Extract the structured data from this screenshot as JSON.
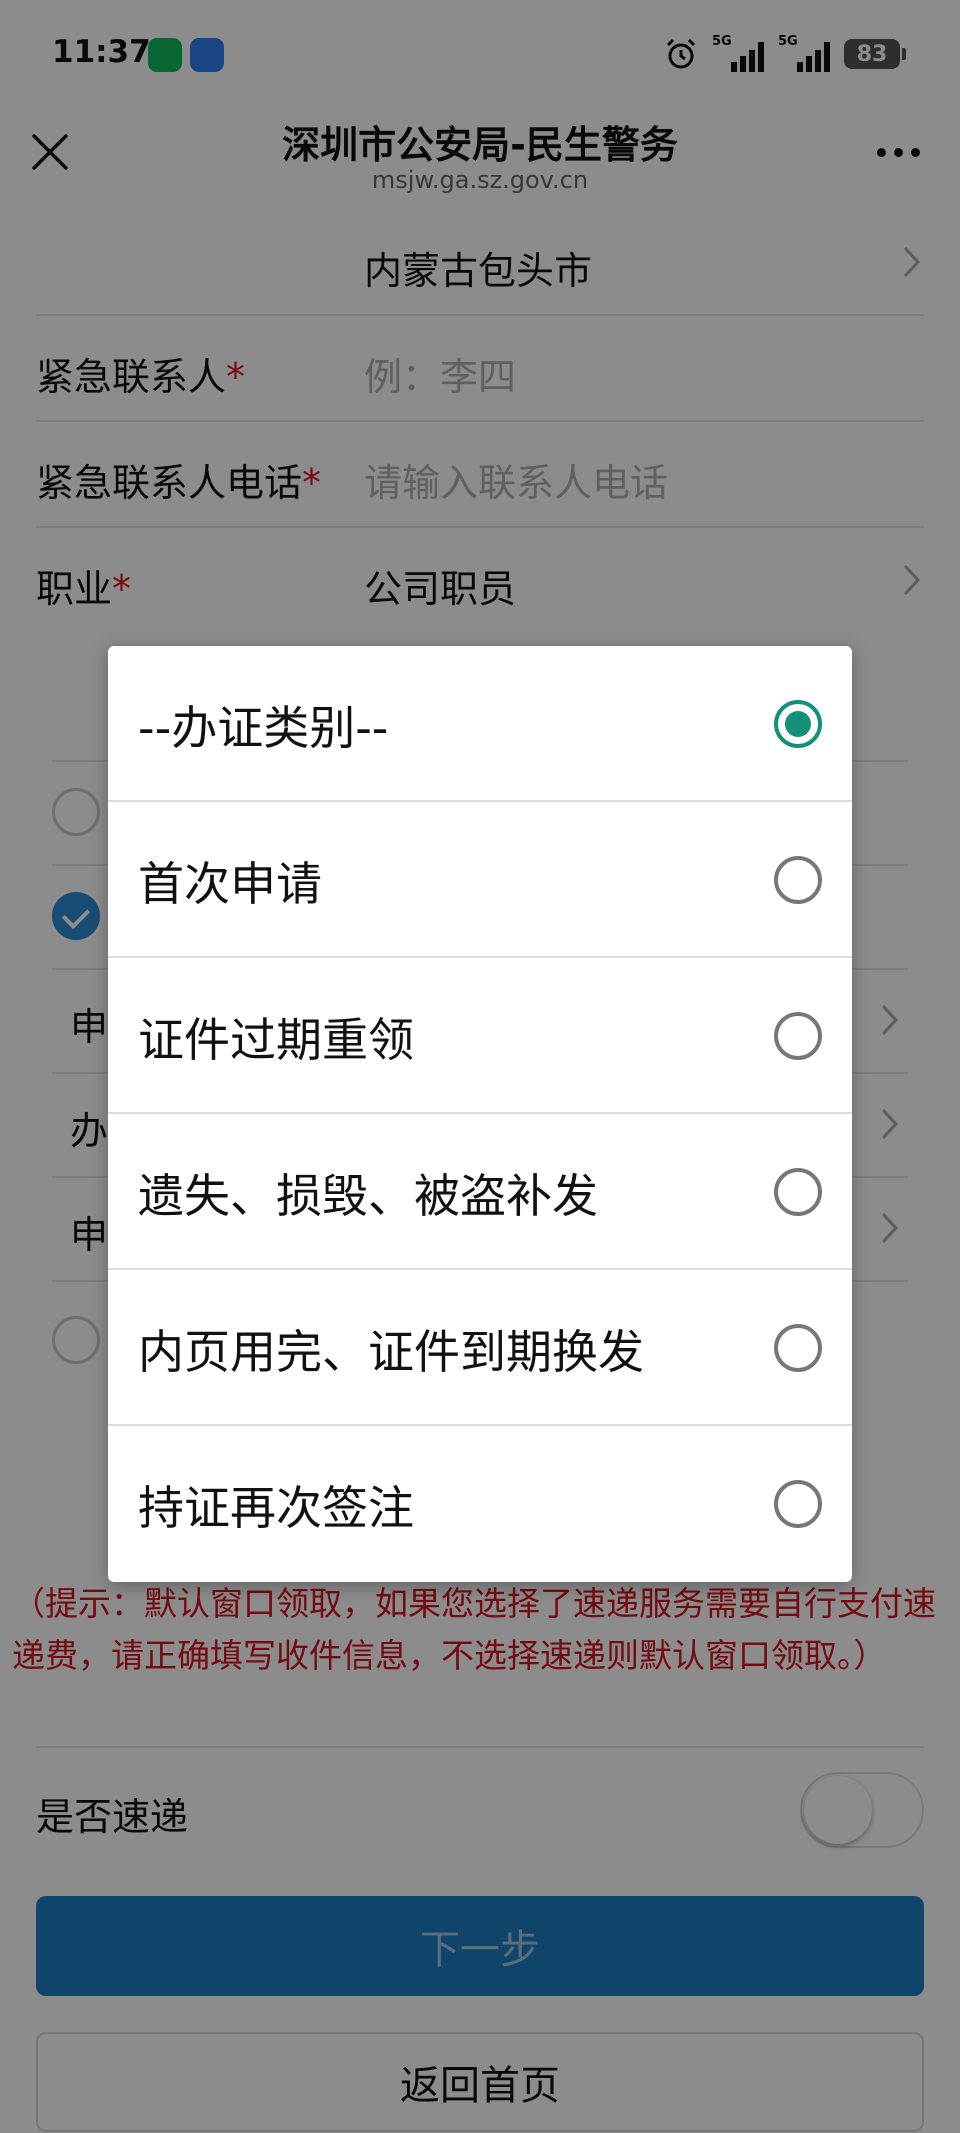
{
  "status_bar": {
    "time": "11:37",
    "network_1": "5G",
    "network_2": "5G",
    "battery": "83",
    "icons": [
      "messages-app-icon",
      "browser-app-icon",
      "alarm-icon",
      "signal-icon",
      "battery-icon"
    ]
  },
  "header": {
    "title": "深圳市公安局-民生警务",
    "url": "msjw.ga.sz.gov.cn"
  },
  "form": {
    "address_value": "内蒙古包头市",
    "emergency_contact_label": "紧急联系人",
    "emergency_contact_placeholder": "例：李四",
    "emergency_phone_label": "紧急联系人电话",
    "emergency_phone_placeholder": "请输入联系人电话",
    "occupation_label": "职业",
    "occupation_value": "公司职员",
    "required_mark": "*",
    "partial_row_1": "申",
    "partial_row_2": "办",
    "partial_row_3": "申"
  },
  "hint": "（提示：默认窗口领取，如果您选择了速递服务需要自行支付速递费，请正确填写收件信息，不选择速递则默认窗口领取。）",
  "express": {
    "label": "是否速递",
    "enabled": false
  },
  "buttons": {
    "next": "下一步",
    "home": "返回首页"
  },
  "dialog": {
    "selected_index": 0,
    "options": [
      "--办证类别--",
      "首次申请",
      "证件过期重领",
      "遗失、损毁、被盗补发",
      "内页用完、证件到期换发",
      "持证再次签注"
    ]
  },
  "colors": {
    "accent_teal": "#12907a",
    "primary_blue": "#1c7ec4",
    "hint_red": "#d6141e"
  }
}
